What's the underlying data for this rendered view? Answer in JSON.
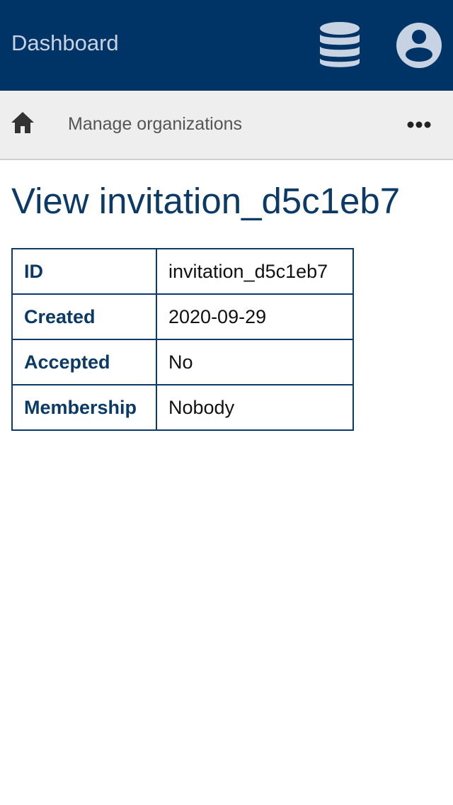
{
  "header": {
    "title": "Dashboard",
    "icons": {
      "database": "database-icon",
      "account": "user-circle-icon"
    },
    "colors": {
      "background": "#003366",
      "icon": "#c7d3e3"
    }
  },
  "nav": {
    "home_icon": "home-icon",
    "link_label": "Manage organizations",
    "more_icon": "more-horizontal-icon"
  },
  "page": {
    "title": "View invitation_d5c1eb7"
  },
  "details": {
    "rows": [
      {
        "label": "ID",
        "value": "invitation_d5c1eb7"
      },
      {
        "label": "Created",
        "value": "2020-09-29"
      },
      {
        "label": "Accepted",
        "value": "No"
      },
      {
        "label": "Membership",
        "value": "Nobody"
      }
    ]
  }
}
